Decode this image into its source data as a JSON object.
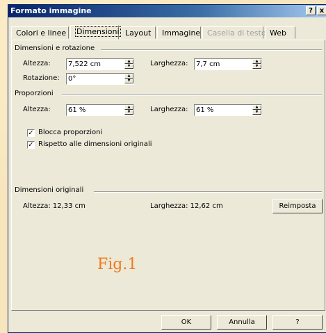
{
  "window": {
    "title": "Formato immagine",
    "help_label": "?",
    "close_label": "x"
  },
  "tabs": [
    {
      "label": "Colori e linee"
    },
    {
      "label": "Dimensioni"
    },
    {
      "label": "Layout"
    },
    {
      "label": "Immagine"
    },
    {
      "label": "Casella di testo"
    },
    {
      "label": "Web"
    }
  ],
  "size_rotation": {
    "heading": "Dimensioni e rotazione",
    "height_label": "Altezza:",
    "height_value": "7,522 cm",
    "width_label": "Larghezza:",
    "width_value": "7,7 cm",
    "rotation_label": "Rotazione:",
    "rotation_value": "0°"
  },
  "scale": {
    "heading": "Proporzioni",
    "height_label": "Altezza:",
    "height_value": "61 %",
    "width_label": "Larghezza:",
    "width_value": "61 %",
    "lock_label": "Blocca proporzioni",
    "lock_checked": true,
    "relative_label": "Rispetto alle dimensioni originali",
    "relative_checked": true
  },
  "original": {
    "heading": "Dimensioni originali",
    "height_text": "Altezza:   12,33 cm",
    "width_text": "Larghezza:   12,62 cm",
    "reset_label": "Reimposta"
  },
  "caption": "Fig.1",
  "buttons": {
    "ok": "OK",
    "cancel": "Annulla",
    "help": "?"
  }
}
